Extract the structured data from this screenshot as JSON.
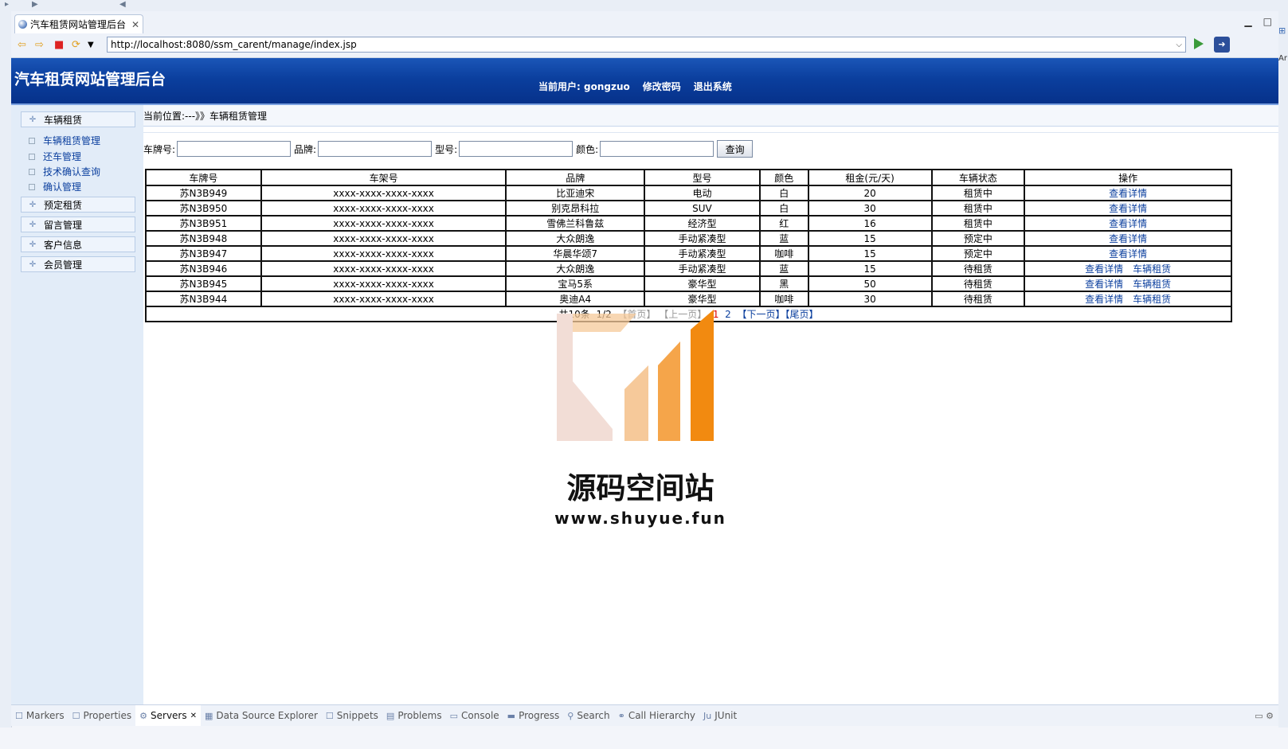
{
  "ide": {
    "tab_title": "汽车租赁网站管理后台",
    "url": "http://localhost:8080/ssm_carent/manage/index.jsp",
    "bottom_views": [
      "Markers",
      "Properties",
      "Servers",
      "Data Source Explorer",
      "Snippets",
      "Problems",
      "Console",
      "Progress",
      "Search",
      "Call Hierarchy",
      "JUnit"
    ],
    "active_view": "Servers",
    "right_strip_text": "Ar"
  },
  "site": {
    "title": "汽车租赁网站管理后台",
    "current_user_label": "当前用户:",
    "current_user": "gongzuo",
    "change_password": "修改密码",
    "logout": "退出系统"
  },
  "sidebar": {
    "groups": [
      {
        "label": "车辆租赁"
      },
      {
        "label": "预定租赁"
      },
      {
        "label": "留言管理"
      },
      {
        "label": "客户信息"
      },
      {
        "label": "会员管理"
      }
    ],
    "sub_items": [
      "车辆租赁管理",
      "还车管理",
      "技术确认查询",
      "确认管理"
    ]
  },
  "breadcrumb": "当前位置:---》》车辆租赁管理",
  "search": {
    "plate_label": "车牌号:",
    "brand_label": "品牌:",
    "model_label": "型号:",
    "color_label": "颜色:",
    "query_button": "查询"
  },
  "table": {
    "headers": [
      "车牌号",
      "车架号",
      "品牌",
      "型号",
      "颜色",
      "租金(元/天)",
      "车辆状态",
      "操作"
    ],
    "rows": [
      {
        "plate": "苏N3B949",
        "vin": "xxxx-xxxx-xxxx-xxxx",
        "brand": "比亚迪宋",
        "model": "电动",
        "color": "白",
        "rent": "20",
        "status": "租赁中",
        "ops": [
          "查看详情"
        ]
      },
      {
        "plate": "苏N3B950",
        "vin": "xxxx-xxxx-xxxx-xxxx",
        "brand": "别克昂科拉",
        "model": "SUV",
        "color": "白",
        "rent": "30",
        "status": "租赁中",
        "ops": [
          "查看详情"
        ]
      },
      {
        "plate": "苏N3B951",
        "vin": "xxxx-xxxx-xxxx-xxxx",
        "brand": "雪佛兰科鲁兹",
        "model": "经济型",
        "color": "红",
        "rent": "16",
        "status": "租赁中",
        "ops": [
          "查看详情"
        ]
      },
      {
        "plate": "苏N3B948",
        "vin": "xxxx-xxxx-xxxx-xxxx",
        "brand": "大众朗逸",
        "model": "手动紧凑型",
        "color": "蓝",
        "rent": "15",
        "status": "预定中",
        "ops": [
          "查看详情"
        ]
      },
      {
        "plate": "苏N3B947",
        "vin": "xxxx-xxxx-xxxx-xxxx",
        "brand": "华晨华颂7",
        "model": "手动紧凑型",
        "color": "咖啡",
        "rent": "15",
        "status": "预定中",
        "ops": [
          "查看详情"
        ]
      },
      {
        "plate": "苏N3B946",
        "vin": "xxxx-xxxx-xxxx-xxxx",
        "brand": "大众朗逸",
        "model": "手动紧凑型",
        "color": "蓝",
        "rent": "15",
        "status": "待租赁",
        "ops": [
          "查看详情",
          "车辆租赁"
        ]
      },
      {
        "plate": "苏N3B945",
        "vin": "xxxx-xxxx-xxxx-xxxx",
        "brand": "宝马5系",
        "model": "豪华型",
        "color": "黑",
        "rent": "50",
        "status": "待租赁",
        "ops": [
          "查看详情",
          "车辆租赁"
        ]
      },
      {
        "plate": "苏N3B944",
        "vin": "xxxx-xxxx-xxxx-xxxx",
        "brand": "奥迪A4",
        "model": "豪华型",
        "color": "咖啡",
        "rent": "30",
        "status": "待租赁",
        "ops": [
          "查看详情",
          "车辆租赁"
        ]
      }
    ]
  },
  "pager": {
    "total": "共10条",
    "page_info": "1/2",
    "first": "【首页】",
    "prev": "【上一页】",
    "page_current": "1",
    "page_other": "2",
    "next": "【下一页】",
    "last": "【尾页】"
  },
  "watermark": {
    "title": "源码空间站",
    "url": "www.shuyue.fun",
    "colors": [
      "#f2ddd6",
      "#f6c99a",
      "#f5a54a",
      "#f28a10"
    ]
  }
}
